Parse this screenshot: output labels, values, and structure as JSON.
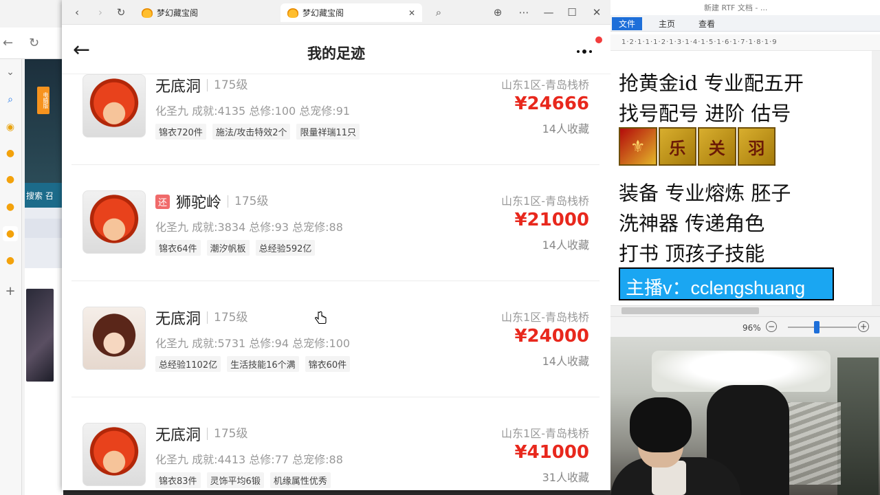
{
  "bg_browser": {
    "nav_back": "←",
    "nav_reload": "↻",
    "sidebar_icons": [
      "chevron-down-icon",
      "search-icon",
      "sun-icon",
      "duck-icon",
      "duck-icon",
      "duck-icon",
      "duck-icon",
      "duck-icon"
    ],
    "badge": "电脑版",
    "tabstrip_text": "搜索  召",
    "add_label": "+"
  },
  "app": {
    "tabs": [
      {
        "label": "梦幻藏宝阁",
        "active": false
      },
      {
        "label": "梦幻藏宝阁",
        "active": true
      }
    ],
    "tab_close": "✕",
    "toolbar": {
      "back": "‹",
      "forward": "›",
      "reload": "↻",
      "search": "⌕",
      "globe": "⊕",
      "more": "⋯",
      "minimize": "—",
      "maximize": "☐",
      "close": "✕"
    },
    "header": {
      "title": "我的足迹",
      "back": "←"
    },
    "items": [
      {
        "avatar": "red-haired-hero",
        "refund": "",
        "name": "无底洞",
        "level": "175级",
        "stats": "化圣九 成就:4135 总修:100 总宠修:91",
        "tags": [
          "锦衣720件",
          "施法/攻击特效2个",
          "限量祥瑞11只"
        ],
        "server": "山东1区-青岛栈桥",
        "price": "¥24666",
        "favs": "14人收藏"
      },
      {
        "avatar": "red-haired-hero",
        "refund": "还",
        "name": "狮驼岭",
        "level": "175级",
        "stats": "化圣九 成就:3834 总修:93 总宠修:88",
        "tags": [
          "锦衣64件",
          "潮汐帆板",
          "总经验592亿"
        ],
        "server": "山东1区-青岛栈桥",
        "price": "¥21000",
        "favs": "14人收藏"
      },
      {
        "avatar": "girl-hero",
        "refund": "",
        "name": "无底洞",
        "level": "175级",
        "stats": "化圣九 成就:5731 总修:94 总宠修:100",
        "tags": [
          "总经验1102亿",
          "生活技能16个满",
          "锦衣60件"
        ],
        "server": "山东1区-青岛栈桥",
        "price": "¥24000",
        "favs": "14人收藏"
      },
      {
        "avatar": "red-haired-hero",
        "refund": "",
        "name": "无底洞",
        "level": "175级",
        "stats": "化圣九 成就:4413 总修:77 总宠修:88",
        "tags": [
          "锦衣83件",
          "灵饰平均6锻",
          "机缘属性优秀"
        ],
        "server": "山东1区-青岛栈桥",
        "price": "¥41000",
        "favs": "31人收藏"
      }
    ]
  },
  "word": {
    "title": "新建 RTF 文档 - ...",
    "ribbon_tabs": [
      "文件",
      "主页",
      "查看"
    ],
    "ruler": "1·2·1·1·1·2·1·3·1·4·1·5·1·6·1·7·1·8·1·9",
    "lines": [
      "抢黄金id 专业配五开",
      "找号配号 进阶 估号",
      "装备 专业熔炼 胚子",
      "洗神器 传递角色",
      "打书 顶孩子技能"
    ],
    "images": [
      "⚜",
      "乐",
      "关",
      "羽"
    ],
    "banner": "主播v：cclengshuang",
    "zoom": "96%",
    "zoom_minus": "−",
    "zoom_plus": "+"
  }
}
